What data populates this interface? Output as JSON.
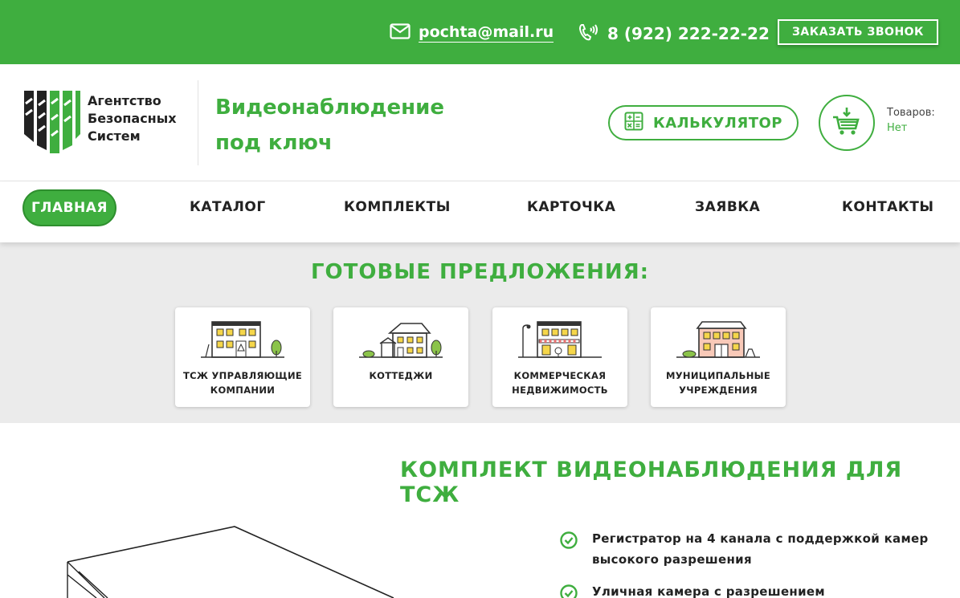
{
  "topbar": {
    "email": "pochta@mail.ru",
    "phone": "8 (922) 222-22-22",
    "callback_label": "ЗАКАЗАТЬ ЗВОНОК",
    "email_icon": "envelope-icon",
    "phone_icon": "phone-icon"
  },
  "header": {
    "logo_line1": "Агентство",
    "logo_line2": "Безопасных",
    "logo_line3": "Систем",
    "tagline_line1": "Видеонаблюдение",
    "tagline_line2": "под ключ",
    "calculator_label": "КАЛЬКУЛЯТОР",
    "calculator_icon": "calculator-icon",
    "cart_icon": "cart-icon",
    "cart_label": "Товаров:",
    "cart_value": "Нет"
  },
  "nav": {
    "items": [
      {
        "label": "ГЛАВНАЯ",
        "active": true
      },
      {
        "label": "КАТАЛОГ"
      },
      {
        "label": "КОМПЛЕКТЫ"
      },
      {
        "label": "КАРТОЧКА"
      },
      {
        "label": "ЗАЯВКА"
      },
      {
        "label": "КОНТАКТЫ"
      }
    ]
  },
  "offers": {
    "title": "ГОТОВЫЕ ПРЕДЛОЖЕНИЯ:",
    "cards": [
      {
        "line1": "ТСЖ УПРАВЛЯЮЩИЕ",
        "line2": "КОМПАНИИ",
        "icon": "apartment-building-icon"
      },
      {
        "line1": "КОТТЕДЖИ",
        "line2": "",
        "icon": "cottage-icon"
      },
      {
        "line1": "КОММЕРЧЕСКАЯ",
        "line2": "НЕДВИЖИМОСТЬ",
        "icon": "commercial-building-icon"
      },
      {
        "line1": "МУНИЦИПАЛЬНЫЕ",
        "line2": "УЧРЕЖДЕНИЯ",
        "icon": "municipal-building-icon"
      }
    ]
  },
  "kit": {
    "title": "КОМПЛЕКТ ВИДЕОНАБЛЮДЕНИЯ ДЛЯ ТСЖ",
    "features": [
      {
        "line1": "Регистратор на 4 канала с поддержкой камер",
        "line2": "высокого разрешения"
      },
      {
        "line1": "Уличная камера с разрешением",
        "line2": ""
      }
    ]
  },
  "colors": {
    "brand_green": "#3fae3f",
    "offers_bg": "#ebebeb"
  }
}
